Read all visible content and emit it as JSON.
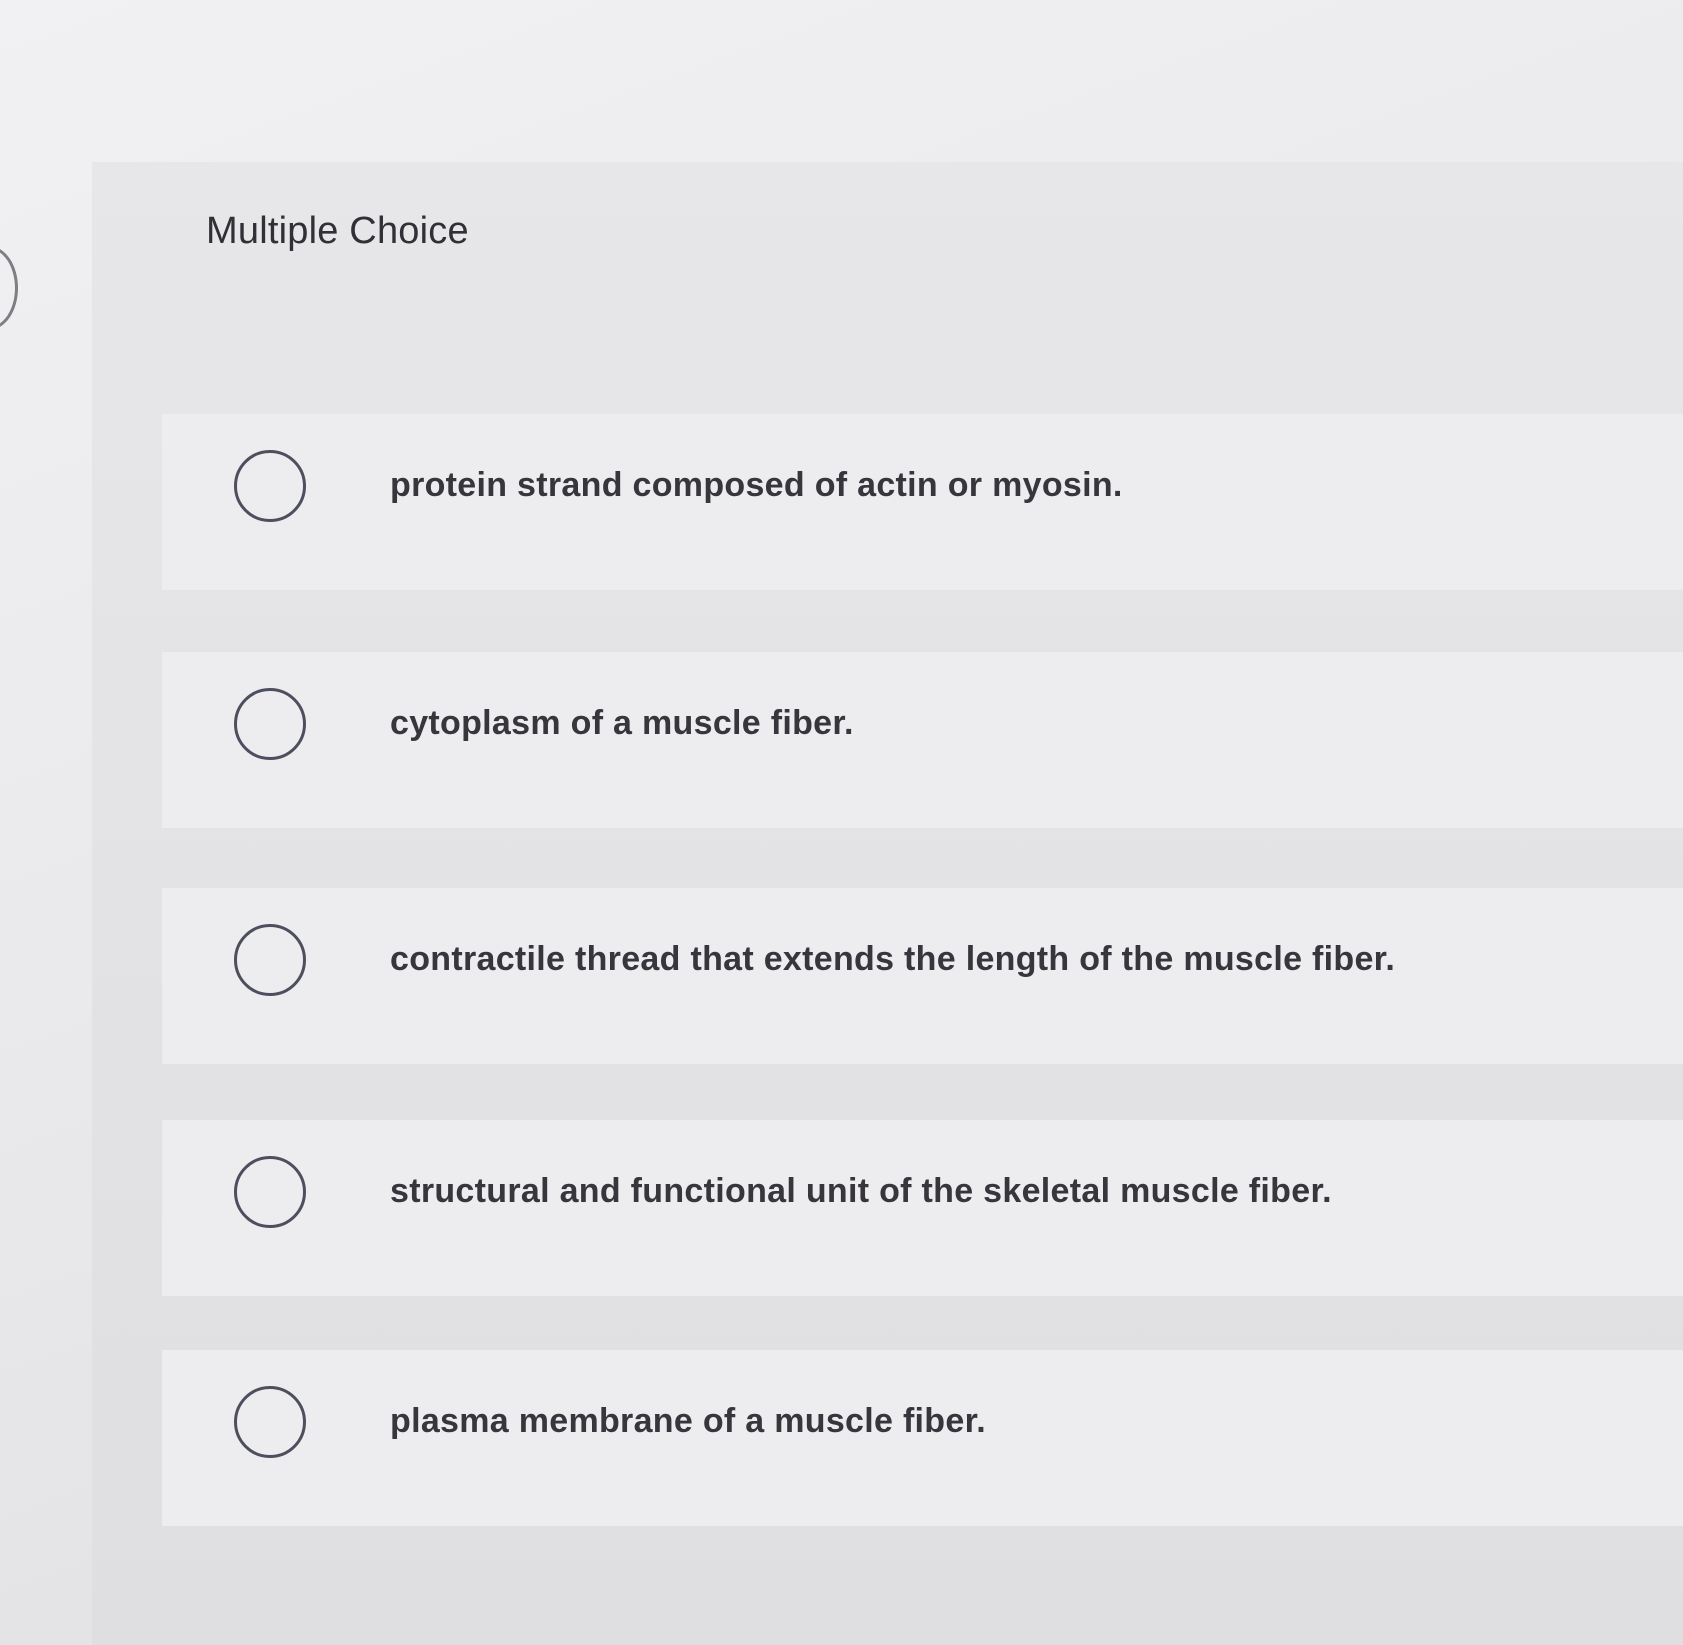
{
  "question": {
    "type_label": "Multiple Choice"
  },
  "choices": [
    {
      "label": "protein strand composed of actin or myosin.",
      "selected": false
    },
    {
      "label": "cytoplasm of a muscle fiber.",
      "selected": false
    },
    {
      "label": "contractile thread that extends the length of the muscle fiber.",
      "selected": false
    },
    {
      "label": "structural and functional unit of the skeletal muscle fiber.",
      "selected": false
    },
    {
      "label": "plasma membrane of a muscle fiber.",
      "selected": false
    }
  ]
}
